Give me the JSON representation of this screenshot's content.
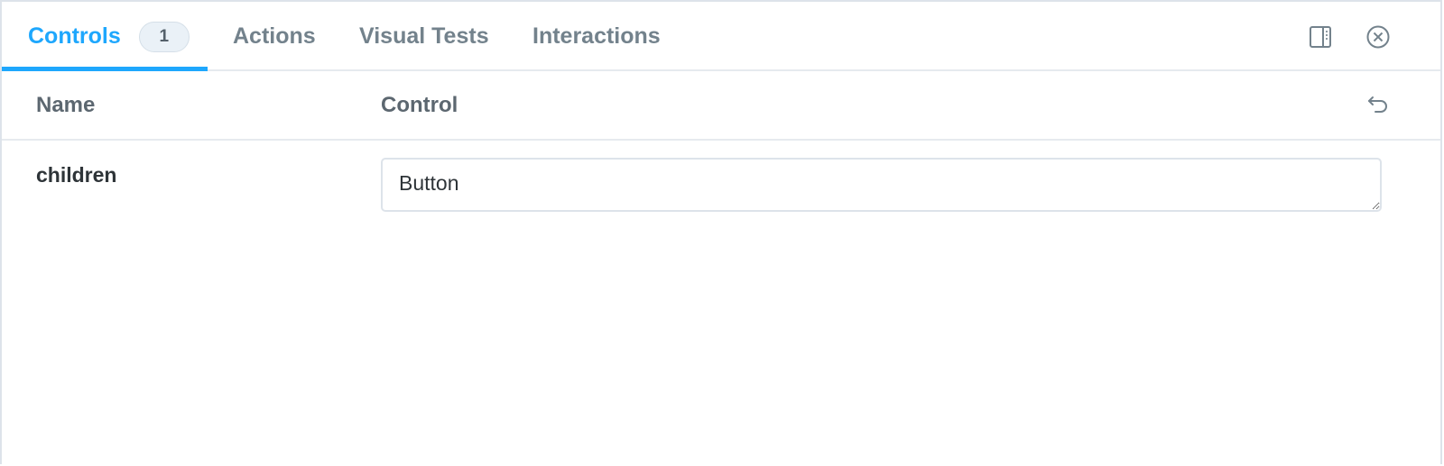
{
  "tabs": [
    {
      "label": "Controls",
      "badge": "1",
      "active": true
    },
    {
      "label": "Actions",
      "active": false
    },
    {
      "label": "Visual Tests",
      "active": false
    },
    {
      "label": "Interactions",
      "active": false
    }
  ],
  "toolbar": {
    "panel_toggle_icon": "sidebar-panel-icon",
    "close_icon": "close-circle-icon"
  },
  "table": {
    "headers": {
      "name": "Name",
      "control": "Control"
    },
    "reset_icon": "undo-icon",
    "rows": [
      {
        "name": "children",
        "value": "Button"
      }
    ]
  },
  "colors": {
    "accent": "#1ea7fd",
    "tab_inactive": "#73828c",
    "border": "#e6eaef",
    "badge_bg": "#eaf1f7"
  }
}
